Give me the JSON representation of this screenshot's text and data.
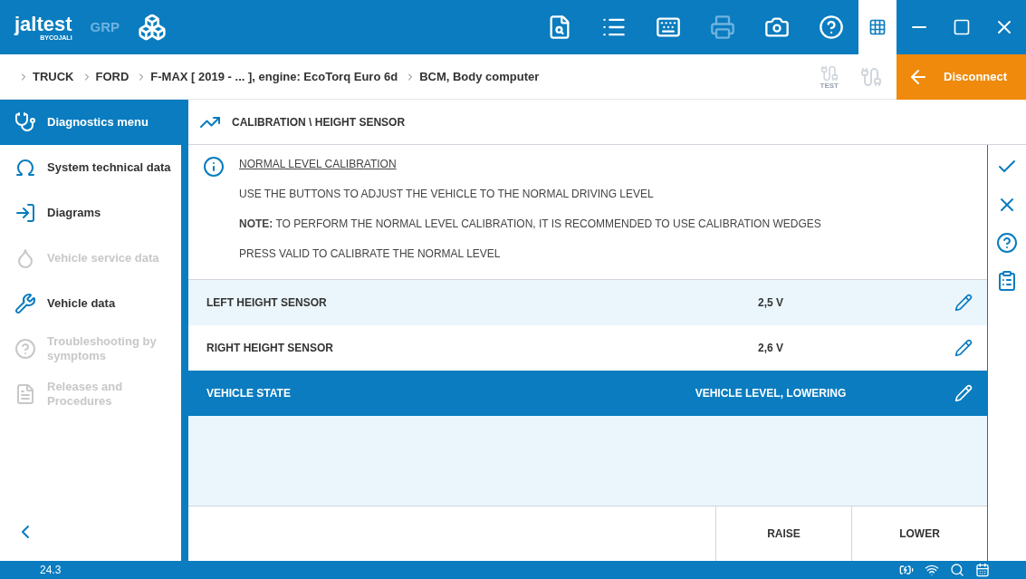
{
  "app": {
    "logo": "jaltest",
    "logo_sub": "BYCOJALI",
    "edition": "GRP"
  },
  "breadcrumb": [
    "TRUCK",
    "FORD",
    "F-MAX [ 2019 - ... ], engine: EcoTorq Euro 6d",
    "BCM, Body computer"
  ],
  "test_label": "TEST",
  "disconnect": "Disconnect",
  "sidebar": {
    "items": [
      {
        "kind": "stethoscope",
        "label": "Diagnostics menu",
        "selected": true,
        "disabled": false
      },
      {
        "kind": "omega",
        "label": "System technical data",
        "selected": false,
        "disabled": false
      },
      {
        "kind": "diagram",
        "label": "Diagrams",
        "selected": false,
        "disabled": false
      },
      {
        "kind": "oil",
        "label": "Vehicle service data",
        "selected": false,
        "disabled": true
      },
      {
        "kind": "wrench",
        "label": "Vehicle data",
        "selected": false,
        "disabled": false
      },
      {
        "kind": "trouble",
        "label": "Troubleshooting by symptoms",
        "selected": false,
        "disabled": true
      },
      {
        "kind": "releases",
        "label": "Releases and Procedures",
        "selected": false,
        "disabled": true
      }
    ]
  },
  "panel": {
    "title": "CALIBRATION \\ HEIGHT SENSOR",
    "info": [
      "NORMAL LEVEL CALIBRATION",
      "USE THE BUTTONS TO ADJUST THE VEHICLE TO THE NORMAL DRIVING LEVEL",
      "**NOTE:** TO PERFORM THE NORMAL LEVEL CALIBRATION, IT IS RECOMMENDED TO USE CALIBRATION WEDGES",
      "PRESS VALID TO CALIBRATE THE NORMAL LEVEL"
    ],
    "rows": [
      {
        "name": "LEFT HEIGHT SENSOR",
        "value": "2,5 V",
        "selected": false
      },
      {
        "name": "RIGHT HEIGHT SENSOR",
        "value": "2,6 V",
        "selected": false
      },
      {
        "name": "VEHICLE STATE",
        "value": "VEHICLE LEVEL, LOWERING",
        "selected": true
      }
    ],
    "buttons": [
      "RAISE",
      "LOWER"
    ]
  },
  "status_bar": {
    "version": "24.3"
  }
}
